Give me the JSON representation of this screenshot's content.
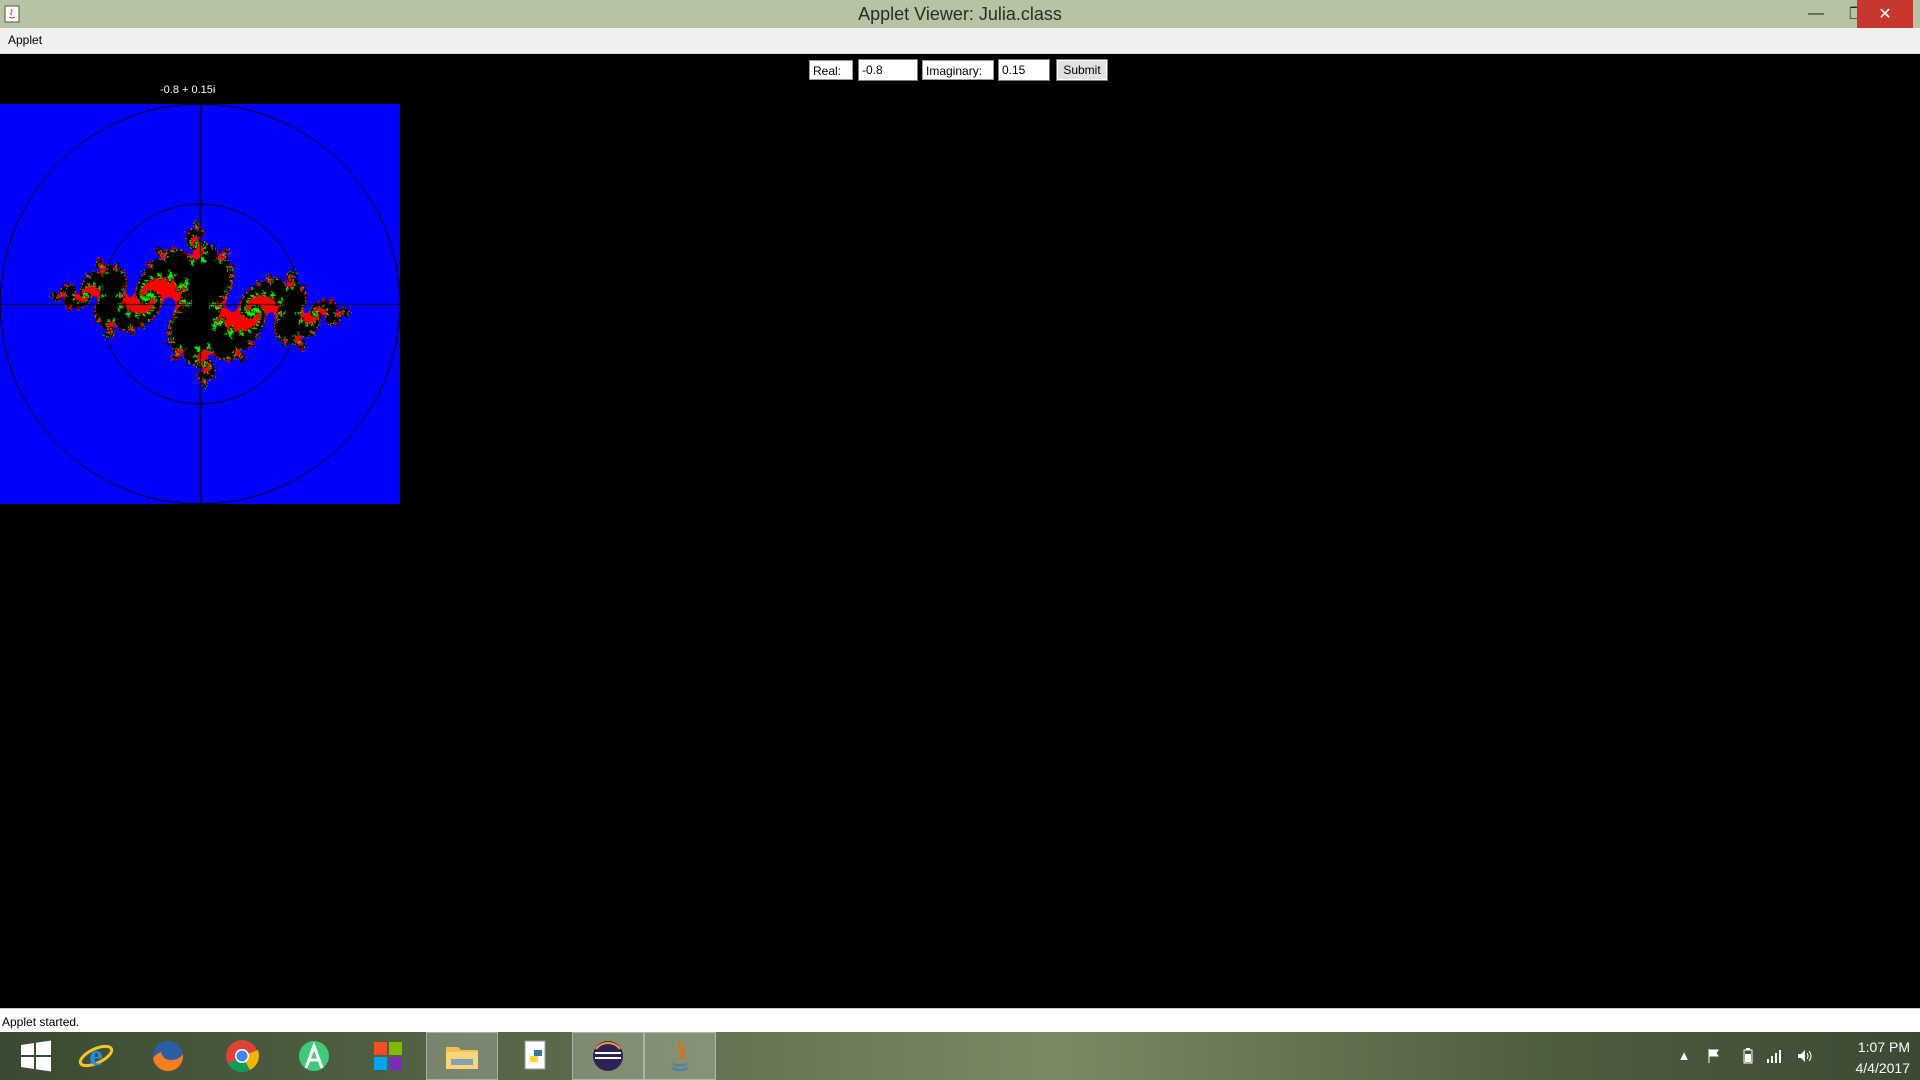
{
  "window": {
    "title": "Applet Viewer: Julia.class",
    "minimize_glyph": "—",
    "maximize_glyph": "❐",
    "close_glyph": "✕"
  },
  "menu": {
    "items": [
      "Applet"
    ]
  },
  "controls": {
    "real_label": "Real:",
    "real_value": "-0.8",
    "imaginary_label": "Imaginary:",
    "imaginary_value": "0.15",
    "submit_label": "Submit"
  },
  "fractal": {
    "caption": "-0.8 + 0.15i",
    "c_real": -0.8,
    "c_imag": 0.15,
    "background_color": "#0000ff",
    "set_color": "#000000",
    "axis_color": "#000000",
    "circles": [
      1,
      2
    ]
  },
  "status": {
    "text": "Applet started."
  },
  "taskbar": {
    "items": [
      {
        "name": "start-icon",
        "active": false
      },
      {
        "name": "internet-explorer-icon",
        "active": false
      },
      {
        "name": "firefox-icon",
        "active": false
      },
      {
        "name": "chrome-icon",
        "active": false
      },
      {
        "name": "android-studio-icon",
        "active": false
      },
      {
        "name": "windows-store-icon",
        "active": false
      },
      {
        "name": "file-explorer-icon",
        "active": true
      },
      {
        "name": "python-icon",
        "active": false
      },
      {
        "name": "eclipse-icon",
        "active": true
      },
      {
        "name": "java-icon",
        "active": true
      }
    ],
    "tray_icons": [
      "show-hidden-icons-icon",
      "action-center-flag-icon",
      "power-icon",
      "network-icon",
      "volume-icon"
    ],
    "clock_time": "1:07 PM",
    "clock_date": "4/4/2017"
  }
}
